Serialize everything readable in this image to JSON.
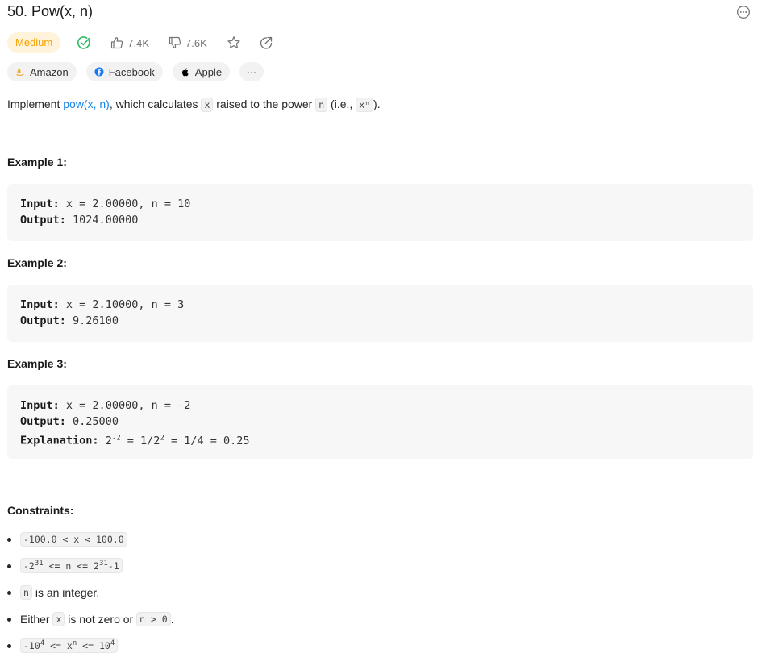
{
  "problem": {
    "title": "50. Pow(x, n)",
    "difficulty": "Medium",
    "likes": "7.4K",
    "dislikes": "7.6K"
  },
  "tags": [
    {
      "label": "Amazon",
      "icon": "amazon-icon"
    },
    {
      "label": "Facebook",
      "icon": "facebook-icon"
    },
    {
      "label": "Apple",
      "icon": "apple-icon"
    },
    {
      "label": "···",
      "icon": "more-icon"
    }
  ],
  "description": {
    "prefix": "Implement ",
    "link": "pow(x, n)",
    "middle": ", which calculates ",
    "x_code": "x",
    "middle2": " raised to the power ",
    "n_code": "n",
    "middle3": " (i.e., ",
    "xn_code": "xⁿ",
    "suffix": ")."
  },
  "examples": [
    {
      "heading": "Example 1:",
      "input_label": "Input:",
      "input": "x = 2.00000, n = 10",
      "output_label": "Output:",
      "output": "1024.00000"
    },
    {
      "heading": "Example 2:",
      "input_label": "Input:",
      "input": "x = 2.10000, n = 3",
      "output_label": "Output:",
      "output": "9.26100"
    },
    {
      "heading": "Example 3:",
      "input_label": "Input:",
      "input": "x = 2.00000, n = -2",
      "output_label": "Output:",
      "output": "0.25000",
      "explanation_label": "Explanation:",
      "explanation_base": "2",
      "explanation_exp": "-2",
      "explanation_mid": " = 1/2",
      "explanation_exp2": "2",
      "explanation_end": " = 1/4 = 0.25"
    }
  ],
  "constraints": {
    "heading": "Constraints:",
    "c1": "-100.0 < x < 100.0",
    "c2_a": "-2",
    "c2_b": "31",
    "c2_c": " <= n <= 2",
    "c2_d": "31",
    "c2_e": "-1",
    "c3_code": "n",
    "c3_text": " is an integer.",
    "c4_a": "Either ",
    "c4_code1": "x",
    "c4_b": " is not zero or ",
    "c4_code2": "n > 0",
    "c4_c": ".",
    "c5_a": "-10",
    "c5_b": "4",
    "c5_c": " <= x",
    "c5_d": "n",
    "c5_e": " <= 10",
    "c5_f": "4"
  },
  "colors": {
    "accent_link": "#1a85e6",
    "difficulty_bg": "#fff4db",
    "difficulty_text": "#f5a300",
    "solved_check": "#2cbb5d"
  }
}
